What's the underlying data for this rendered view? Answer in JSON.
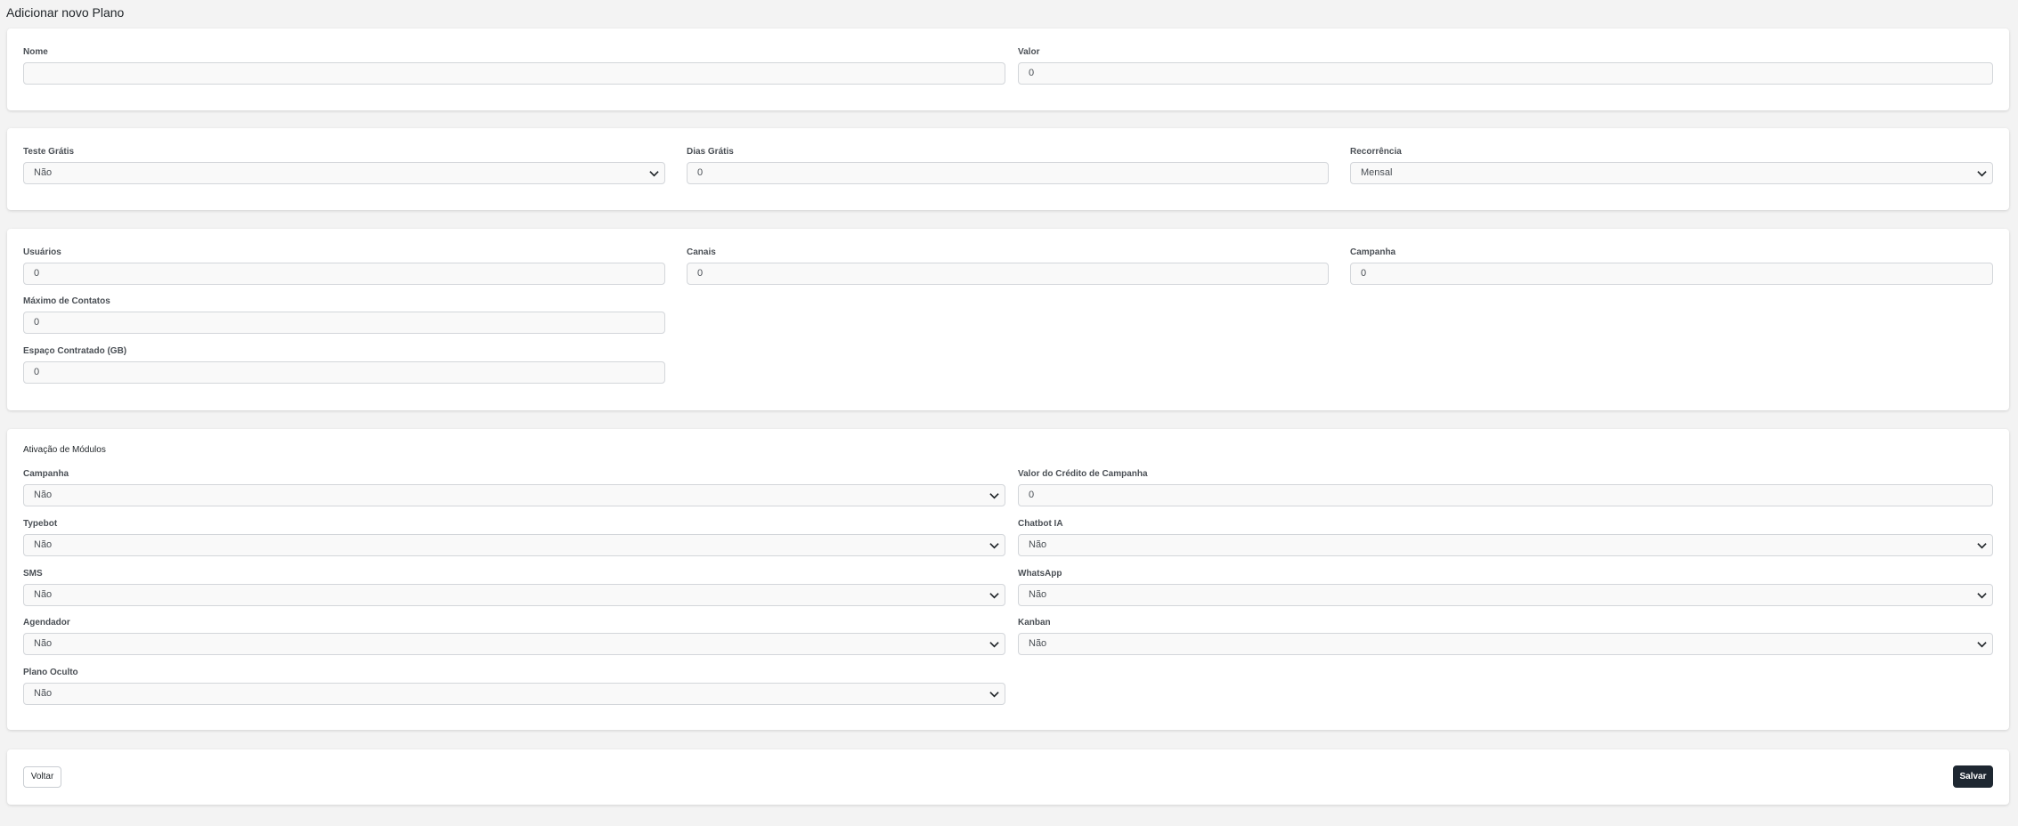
{
  "page": {
    "title": "Adicionar novo Plano"
  },
  "basic": {
    "name": {
      "label": "Nome",
      "value": ""
    },
    "value": {
      "label": "Valor",
      "value": "0"
    }
  },
  "trial": {
    "free_trial": {
      "label": "Teste Grátis",
      "value": "Não"
    },
    "free_days": {
      "label": "Dias Grátis",
      "value": "0"
    },
    "recurrence": {
      "label": "Recorrência",
      "value": "Mensal"
    }
  },
  "limits": {
    "users": {
      "label": "Usuários",
      "value": "0"
    },
    "channels": {
      "label": "Canais",
      "value": "0"
    },
    "campaign": {
      "label": "Campanha",
      "value": "0"
    },
    "max_contacts": {
      "label": "Máximo de Contatos",
      "value": "0"
    },
    "storage": {
      "label": "Espaço Contratado (GB)",
      "value": "0"
    }
  },
  "modules": {
    "title": "Ativação de Módulos",
    "campaign": {
      "label": "Campanha",
      "value": "Não"
    },
    "campaign_credit": {
      "label": "Valor do Crédito de Campanha",
      "value": "0"
    },
    "typebot": {
      "label": "Typebot",
      "value": "Não"
    },
    "chatbot_ia": {
      "label": "Chatbot IA",
      "value": "Não"
    },
    "sms": {
      "label": "SMS",
      "value": "Não"
    },
    "whatsapp": {
      "label": "WhatsApp",
      "value": "Não"
    },
    "scheduler": {
      "label": "Agendador",
      "value": "Não"
    },
    "kanban": {
      "label": "Kanban",
      "value": "Não"
    },
    "hidden_plan": {
      "label": "Plano Oculto",
      "value": "Não"
    }
  },
  "actions": {
    "back_label": "Voltar",
    "save_label": "Salvar"
  },
  "colors": {
    "background": "#f3f3f3",
    "card": "#ffffff",
    "primary_button": "#1e2731",
    "input_border": "#d3d6da"
  },
  "icons": {
    "select_arrow": "chevron-down-icon"
  }
}
